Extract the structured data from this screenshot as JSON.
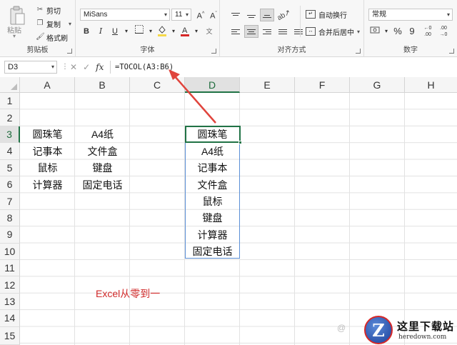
{
  "ribbon": {
    "clipboard": {
      "paste_label": "粘贴",
      "cut": "剪切",
      "copy": "复制",
      "format_painter": "格式刷",
      "group_label": "剪贴板"
    },
    "font": {
      "font_name": "MiSans",
      "font_size": "11",
      "grow_icon": "A^",
      "shrink_icon": "Aˇ",
      "bold": "B",
      "italic": "I",
      "underline": "U",
      "group_label": "字体"
    },
    "alignment": {
      "wrap_text": "自动换行",
      "merge_center": "合并后居中",
      "group_label": "对齐方式"
    },
    "number": {
      "format": "常规",
      "percent": "%",
      "comma": "9",
      "group_label": "数字"
    }
  },
  "formula_bar": {
    "name_box": "D3",
    "formula": "=TOCOL(A3:B6)"
  },
  "sheet": {
    "columns": [
      "A",
      "B",
      "C",
      "D",
      "E",
      "F",
      "G",
      "H"
    ],
    "rows": [
      "1",
      "2",
      "3",
      "4",
      "5",
      "6",
      "7",
      "8",
      "9",
      "10",
      "11",
      "12",
      "13",
      "14",
      "15"
    ],
    "active_column": "D",
    "active_row": "3",
    "col_a": [
      "圆珠笔",
      "记事本",
      "鼠标",
      "计算器"
    ],
    "col_b": [
      "A4纸",
      "文件盒",
      "键盘",
      "固定电话"
    ],
    "col_d": [
      "圆珠笔",
      "A4纸",
      "记事本",
      "文件盒",
      "鼠标",
      "键盘",
      "计算器",
      "固定电话"
    ],
    "note": "Excel从零到一"
  },
  "colors": {
    "accent": "#217346",
    "arrow": "#e0443c",
    "note": "#d12b2b"
  },
  "logo": {
    "title": "这里下载站",
    "url": "heredown.com",
    "letter": "Z",
    "faint_text": "@"
  }
}
